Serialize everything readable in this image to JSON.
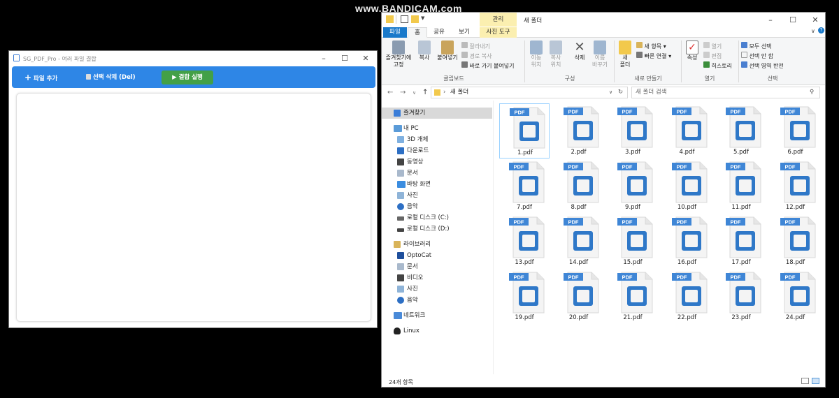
{
  "watermark": "www.BANDICAM.com",
  "app": {
    "title": "SG_PDF_Pro - 여러 파일 결합",
    "buttons": {
      "add_files": "파일 추가",
      "delete_selected": "선택 삭제 (Del)",
      "run_merge": "결합 실행"
    },
    "colors": {
      "toolbar": "#2e86e6",
      "run_button": "#43a047"
    }
  },
  "explorer": {
    "context_tab": "관리",
    "title": "새 폴더",
    "tabs": [
      "파일",
      "홈",
      "공유",
      "보기",
      "사진 도구"
    ],
    "ribbon": {
      "clipboard": {
        "pin_line1": "즐겨찾기에",
        "pin_line2": "고정",
        "copy": "복사",
        "paste": "붙여넣기",
        "cut": "잘라내기",
        "copy_path": "경로 복사",
        "paste_shortcut": "바로 가기 붙여넣기",
        "group_label": "클립보드"
      },
      "organize": {
        "move_line1": "이동",
        "move_line2": "위치",
        "copyto_line1": "복사",
        "copyto_line2": "위치",
        "delete": "삭제",
        "rename_line1": "이름",
        "rename_line2": "바꾸기",
        "group_label": "구성"
      },
      "new": {
        "new_folder_line1": "새",
        "new_folder_line2": "폴더",
        "new_item": "새 항목",
        "easy_access": "빠른 연결",
        "group_label": "새로 만들기"
      },
      "open": {
        "properties": "속성",
        "open": "열기",
        "edit": "편집",
        "history": "히스토리",
        "group_label": "열기"
      },
      "select": {
        "select_all": "모두 선택",
        "select_none": "선택 안 함",
        "invert": "선택 영역 반전",
        "group_label": "선택"
      }
    },
    "address": "새 폴더",
    "search_placeholder": "새 폴더 검색",
    "nav": [
      "즐겨찾기",
      "내 PC",
      "3D 개체",
      "다운로드",
      "동영상",
      "문서",
      "바탕 화면",
      "사진",
      "음악",
      "로컬 디스크 (C:)",
      "로컬 디스크 (D:)",
      "라이브러리",
      "OptoCat",
      "문서",
      "비디오",
      "사진",
      "음악",
      "네트워크",
      "Linux"
    ],
    "pdf_badge": "PDF",
    "files": [
      "1.pdf",
      "2.pdf",
      "3.pdf",
      "4.pdf",
      "5.pdf",
      "6.pdf",
      "7.pdf",
      "8.pdf",
      "9.pdf",
      "10.pdf",
      "11.pdf",
      "12.pdf",
      "13.pdf",
      "14.pdf",
      "15.pdf",
      "16.pdf",
      "17.pdf",
      "18.pdf",
      "19.pdf",
      "20.pdf",
      "21.pdf",
      "22.pdf",
      "23.pdf",
      "24.pdf"
    ],
    "status": "24개 항목"
  }
}
